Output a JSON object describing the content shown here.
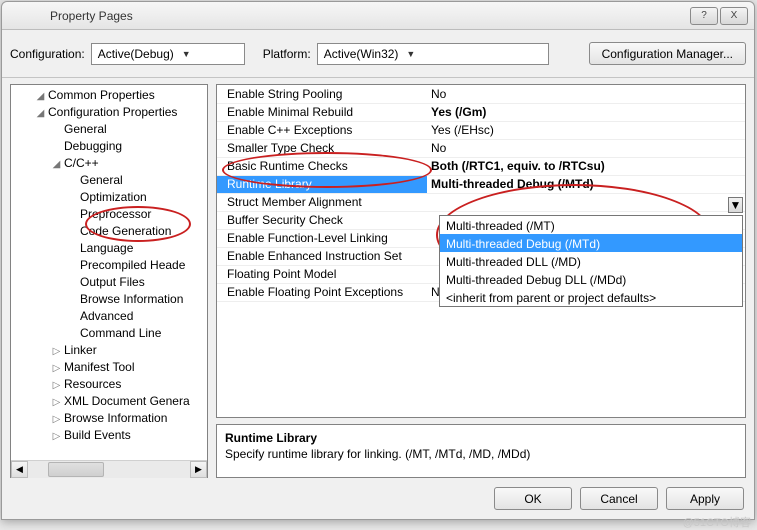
{
  "window": {
    "title": "Property Pages",
    "help": "?",
    "close": "X"
  },
  "toprow": {
    "config_label": "Configuration:",
    "config_value": "Active(Debug)",
    "platform_label": "Platform:",
    "platform_value": "Active(Win32)",
    "manager_btn": "Configuration Manager..."
  },
  "tree": [
    {
      "indent": 1,
      "exp": "◢",
      "label": "Common Properties"
    },
    {
      "indent": 1,
      "exp": "◢",
      "label": "Configuration Properties"
    },
    {
      "indent": 2,
      "exp": "",
      "label": "General"
    },
    {
      "indent": 2,
      "exp": "",
      "label": "Debugging"
    },
    {
      "indent": 2,
      "exp": "◢",
      "label": "C/C++"
    },
    {
      "indent": 3,
      "exp": "",
      "label": "General"
    },
    {
      "indent": 3,
      "exp": "",
      "label": "Optimization"
    },
    {
      "indent": 3,
      "exp": "",
      "label": "Preprocessor"
    },
    {
      "indent": 3,
      "exp": "",
      "label": "Code Generation"
    },
    {
      "indent": 3,
      "exp": "",
      "label": "Language"
    },
    {
      "indent": 3,
      "exp": "",
      "label": "Precompiled Heade"
    },
    {
      "indent": 3,
      "exp": "",
      "label": "Output Files"
    },
    {
      "indent": 3,
      "exp": "",
      "label": "Browse Information"
    },
    {
      "indent": 3,
      "exp": "",
      "label": "Advanced"
    },
    {
      "indent": 3,
      "exp": "",
      "label": "Command Line"
    },
    {
      "indent": 2,
      "exp": "▷",
      "label": "Linker"
    },
    {
      "indent": 2,
      "exp": "▷",
      "label": "Manifest Tool"
    },
    {
      "indent": 2,
      "exp": "▷",
      "label": "Resources"
    },
    {
      "indent": 2,
      "exp": "▷",
      "label": "XML Document Genera"
    },
    {
      "indent": 2,
      "exp": "▷",
      "label": "Browse Information"
    },
    {
      "indent": 2,
      "exp": "▷",
      "label": "Build Events"
    }
  ],
  "grid_before": [
    {
      "name": "Enable String Pooling",
      "value": "No",
      "bold": false
    },
    {
      "name": "Enable Minimal Rebuild",
      "value": "Yes (/Gm)",
      "bold": true
    },
    {
      "name": "Enable C++ Exceptions",
      "value": "Yes (/EHsc)",
      "bold": false
    },
    {
      "name": "Smaller Type Check",
      "value": "No",
      "bold": false
    },
    {
      "name": "Basic Runtime Checks",
      "value": "Both (/RTC1, equiv. to /RTCsu)",
      "bold": true
    }
  ],
  "grid_selected": {
    "name": "Runtime Library",
    "value": "Multi-threaded Debug (/MTd)"
  },
  "grid_mid": {
    "name": "Struct Member Alignment",
    "value": ""
  },
  "grid_after": [
    {
      "name": "Buffer Security Check",
      "value": ""
    },
    {
      "name": "Enable Function-Level Linking",
      "value": ""
    },
    {
      "name": "Enable Enhanced Instruction Set",
      "value": ""
    },
    {
      "name": "Floating Point Model",
      "value": ""
    },
    {
      "name": "Enable Floating Point Exceptions",
      "value": "No"
    }
  ],
  "dropdown": {
    "options": [
      "Multi-threaded (/MT)",
      "Multi-threaded Debug (/MTd)",
      "Multi-threaded DLL (/MD)",
      "Multi-threaded Debug DLL (/MDd)",
      "<inherit from parent or project defaults>"
    ],
    "selected_index": 1
  },
  "desc": {
    "title": "Runtime Library",
    "body": "Specify runtime library for linking.     (/MT, /MTd, /MD, /MDd)"
  },
  "buttons": {
    "ok": "OK",
    "cancel": "Cancel",
    "apply": "Apply"
  },
  "watermark": "@51CTO博客"
}
